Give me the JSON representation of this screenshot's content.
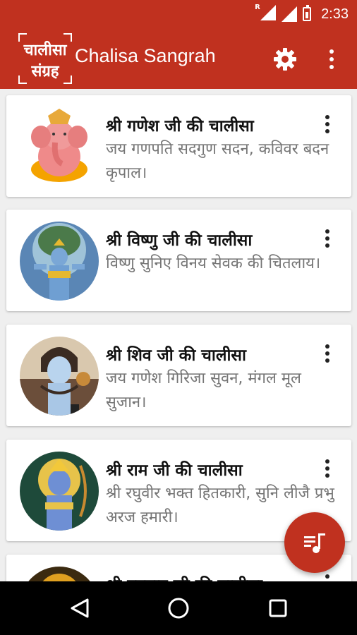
{
  "status_bar": {
    "time": "2:33",
    "roaming_label": "R"
  },
  "app_bar": {
    "logo_line1": "चालीसा",
    "logo_line2": "संग्रह",
    "title": "Chalisa Sangrah",
    "settings_icon": "settings-icon",
    "overflow_icon": "more-vert-icon"
  },
  "chalisa_list": [
    {
      "title": "श्री गणेश जी की चालीसा",
      "subtitle": "जय गणपति सदगुण सदन, कविवर बदन कृपाल।",
      "deity": "ganesh"
    },
    {
      "title": "श्री विष्णु जी की चालीसा",
      "subtitle": "विष्णु सुनिए विनय सेवक की चितलाय।",
      "deity": "vishnu"
    },
    {
      "title": "श्री शिव जी की चालीसा",
      "subtitle": "जय गणेश गिरिजा सुवन, मंगल मूल सुजान।",
      "deity": "shiv"
    },
    {
      "title": "श्री राम जी की चालीसा",
      "subtitle": "श्री रघुवीर भक्त हितकारी, सुनि लीजै प्रभु अरज हमारी।",
      "deity": "ram"
    },
    {
      "title": "श्री हनुमान जी की चालीसा",
      "subtitle": "",
      "deity": "hanuman"
    }
  ],
  "fab": {
    "icon": "playlist-music-icon"
  },
  "nav_bar": {
    "back_icon": "back-icon",
    "home_icon": "home-icon",
    "recents_icon": "recents-icon"
  },
  "colors": {
    "primary": "#c0311f",
    "background": "#efefef",
    "subtitle": "#757575"
  }
}
